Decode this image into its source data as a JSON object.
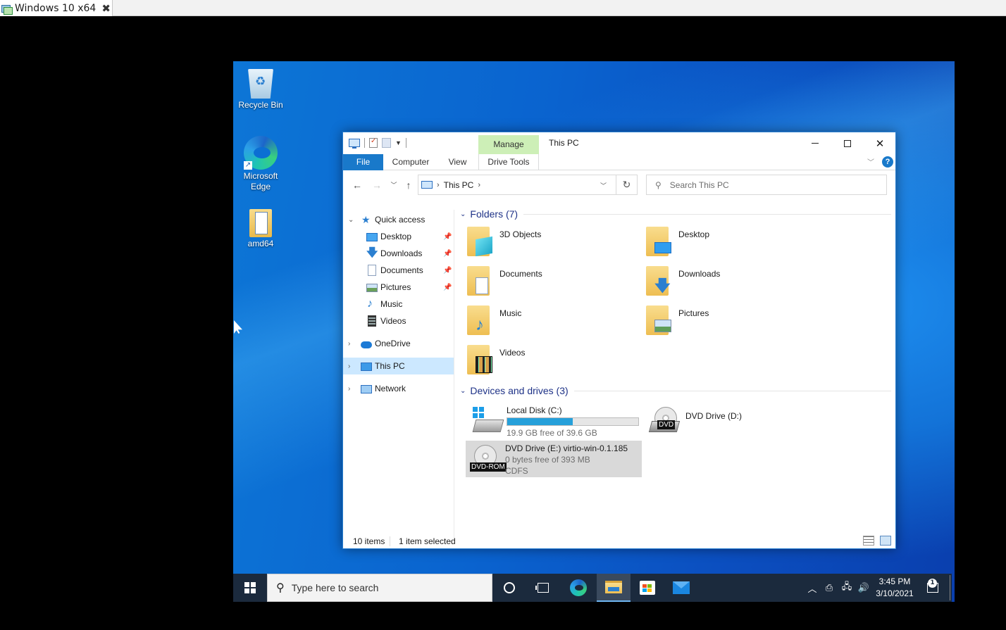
{
  "host": {
    "tab_title": "Windows 10 x64",
    "tab_close": "✖"
  },
  "desktop": {
    "icons": [
      {
        "label": "Recycle Bin"
      },
      {
        "label": "Microsoft Edge"
      },
      {
        "label": "amd64"
      }
    ]
  },
  "explorer": {
    "title": "This PC",
    "context_tab": "Manage",
    "ribbon_tabs": [
      "File",
      "Computer",
      "View",
      "Drive Tools"
    ],
    "help": "?",
    "address": {
      "path": "This PC",
      "search_placeholder": "Search This PC"
    },
    "nav": {
      "quick_access": "Quick access",
      "items": [
        {
          "label": "Desktop",
          "pinned": true
        },
        {
          "label": "Downloads",
          "pinned": true
        },
        {
          "label": "Documents",
          "pinned": true
        },
        {
          "label": "Pictures",
          "pinned": true
        },
        {
          "label": "Music",
          "pinned": false
        },
        {
          "label": "Videos",
          "pinned": false
        }
      ],
      "onedrive": "OneDrive",
      "this_pc": "This PC",
      "network": "Network",
      "pin_glyph": "📌"
    },
    "folders_header": "Folders (7)",
    "folders": [
      "3D Objects",
      "Desktop",
      "Documents",
      "Downloads",
      "Music",
      "Pictures",
      "Videos"
    ],
    "drives_header": "Devices and drives (3)",
    "drives": {
      "c": {
        "name": "Local Disk (C:)",
        "free": "19.9 GB free of 39.6 GB",
        "used_fraction": 0.5
      },
      "d": {
        "name": "DVD Drive (D:)",
        "badge": "DVD"
      },
      "e": {
        "name": "DVD Drive (E:) virtio-win-0.1.185",
        "free": "0 bytes free of 393 MB",
        "fs": "CDFS",
        "badge": "DVD-ROM"
      }
    },
    "status": {
      "count": "10 items",
      "selected": "1 item selected"
    }
  },
  "taskbar": {
    "search_placeholder": "Type here to search",
    "time": "3:45 PM",
    "date": "3/10/2021",
    "notification_count": "1",
    "accent": "#1979ca"
  }
}
